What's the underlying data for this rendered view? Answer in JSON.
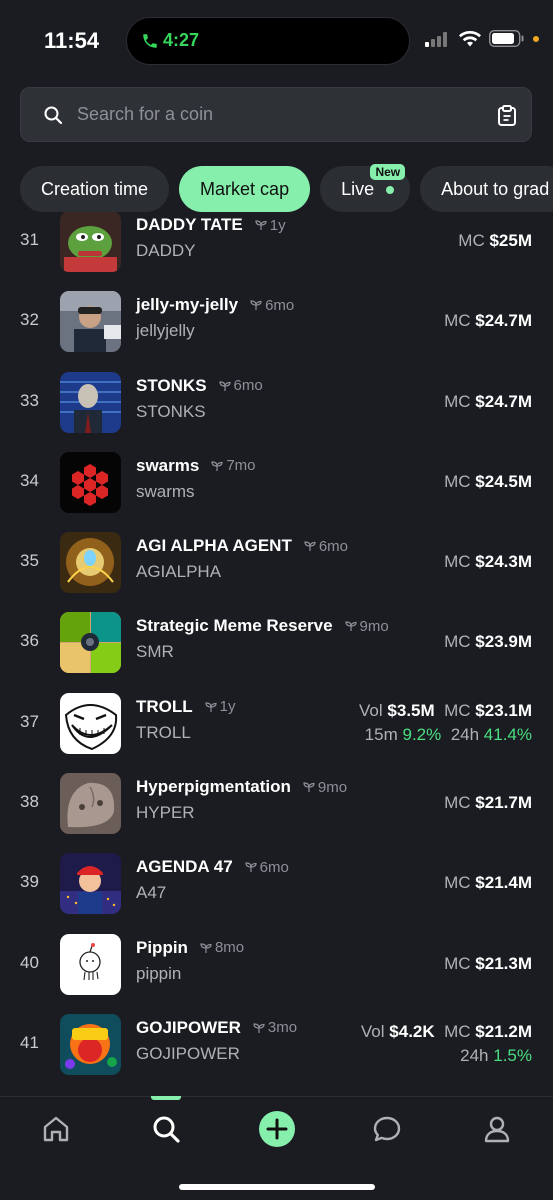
{
  "status": {
    "time": "11:54",
    "call_time": "4:27"
  },
  "search": {
    "placeholder": "Search for a coin"
  },
  "tabs": [
    {
      "label": "Creation time",
      "active": false
    },
    {
      "label": "Market cap",
      "active": true
    },
    {
      "label": "Live",
      "badge": "New",
      "active": false
    },
    {
      "label": "About to grad",
      "active": false
    }
  ],
  "coins": [
    {
      "rank": "31",
      "name": "DADDY TATE",
      "age": "1y",
      "ticker": "DADDY",
      "mc_label": "MC",
      "mc": "$25M"
    },
    {
      "rank": "32",
      "name": "jelly-my-jelly",
      "age": "6mo",
      "ticker": "jellyjelly",
      "mc_label": "MC",
      "mc": "$24.7M"
    },
    {
      "rank": "33",
      "name": "STONKS",
      "age": "6mo",
      "ticker": "STONKS",
      "mc_label": "MC",
      "mc": "$24.7M"
    },
    {
      "rank": "34",
      "name": "swarms",
      "age": "7mo",
      "ticker": "swarms",
      "mc_label": "MC",
      "mc": "$24.5M"
    },
    {
      "rank": "35",
      "name": "AGI ALPHA AGENT",
      "age": "6mo",
      "ticker": "AGIALPHA",
      "mc_label": "MC",
      "mc": "$24.3M"
    },
    {
      "rank": "36",
      "name": "Strategic Meme Reserve",
      "age": "9mo",
      "ticker": "SMR",
      "mc_label": "MC",
      "mc": "$23.9M"
    },
    {
      "rank": "37",
      "name": "TROLL",
      "age": "1y",
      "ticker": "TROLL",
      "vol_label": "Vol",
      "vol": "$3.5M",
      "mc_label": "MC",
      "mc": "$23.1M",
      "c15m_label": "15m",
      "c15m": "9.2%",
      "c24h_label": "24h",
      "c24h": "41.4%"
    },
    {
      "rank": "38",
      "name": "Hyperpigmentation",
      "age": "9mo",
      "ticker": "HYPER",
      "mc_label": "MC",
      "mc": "$21.7M"
    },
    {
      "rank": "39",
      "name": "AGENDA 47",
      "age": "6mo",
      "ticker": "A47",
      "mc_label": "MC",
      "mc": "$21.4M"
    },
    {
      "rank": "40",
      "name": "Pippin",
      "age": "8mo",
      "ticker": "pippin",
      "mc_label": "MC",
      "mc": "$21.3M"
    },
    {
      "rank": "41",
      "name": "GOJIPOWER",
      "age": "3mo",
      "ticker": "GOJIPOWER",
      "vol_label": "Vol",
      "vol": "$4.2K",
      "mc_label": "MC",
      "mc": "$21.2M",
      "c24h_label": "24h",
      "c24h": "1.5%"
    }
  ],
  "nav": [
    "home-icon",
    "search-icon",
    "add-icon",
    "chat-icon",
    "profile-icon"
  ],
  "colors": {
    "accent": "#86efac",
    "positive": "#4ade80",
    "background": "#1a1c21"
  }
}
